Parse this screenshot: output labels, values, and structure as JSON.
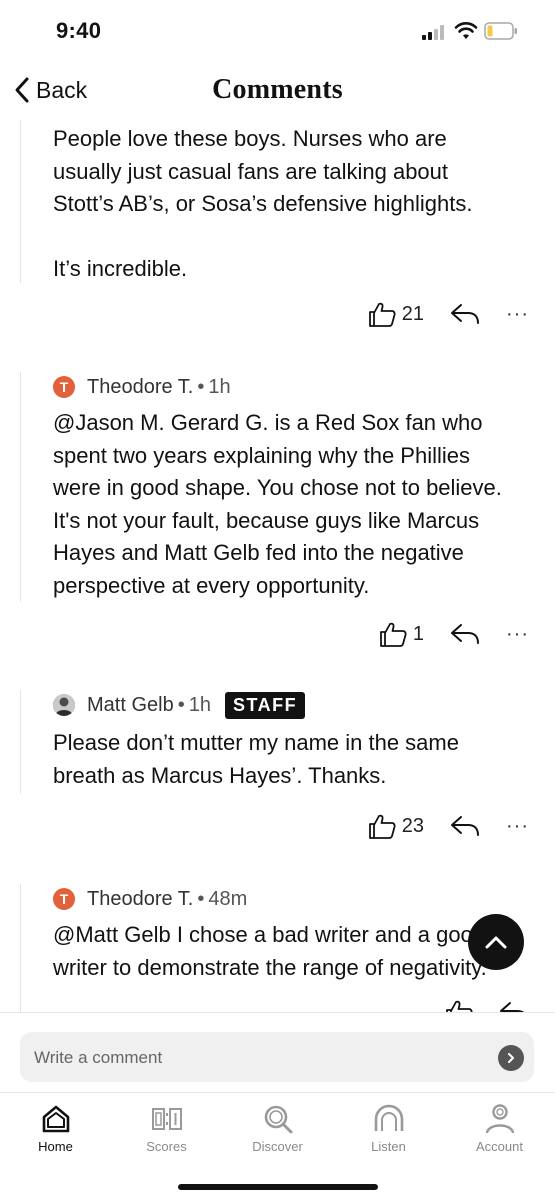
{
  "status": {
    "time": "9:40"
  },
  "nav": {
    "back_label": "Back",
    "title": "Comments"
  },
  "comments": [
    {
      "body": [
        "People love these boys. Nurses who are",
        "usually just casual fans are talking about",
        "Stott’s AB’s, or Sosa’s defensive highlights.",
        "",
        "It’s incredible."
      ],
      "likes": "21"
    },
    {
      "avatar_letter": "T",
      "author": "Theodore T.",
      "time": "1h",
      "body": [
        "@Jason M. Gerard G. is a Red Sox fan who",
        "spent two years explaining why the Phillies",
        "were in good shape. You chose not to believe.",
        "It's not your fault, because guys like Marcus",
        "Hayes and Matt Gelb fed into the negative",
        "perspective at every opportunity."
      ],
      "likes": "1"
    },
    {
      "author": "Matt Gelb",
      "time": "1h",
      "badge": "STAFF",
      "body": [
        "Please don’t mutter my name in the same",
        "breath as Marcus Hayes’. Thanks."
      ],
      "likes": "23"
    },
    {
      "avatar_letter": "T",
      "author": "Theodore T.",
      "time": "48m",
      "body": [
        "@Matt Gelb I chose a bad writer and a good",
        "writer to demonstrate the range of negativity."
      ]
    }
  ],
  "more_label": "···",
  "composer": {
    "placeholder": "Write a comment"
  },
  "tabs": [
    {
      "label": "Home",
      "icon": "home-icon",
      "active": true
    },
    {
      "label": "Scores",
      "icon": "scoreboard-icon"
    },
    {
      "label": "Discover",
      "icon": "search-icon"
    },
    {
      "label": "Listen",
      "icon": "headphones-icon"
    },
    {
      "label": "Account",
      "icon": "person-icon"
    }
  ],
  "colors": {
    "accent_avatar": "#e2603a",
    "text": "#121212",
    "muted": "#8a8a8a"
  }
}
